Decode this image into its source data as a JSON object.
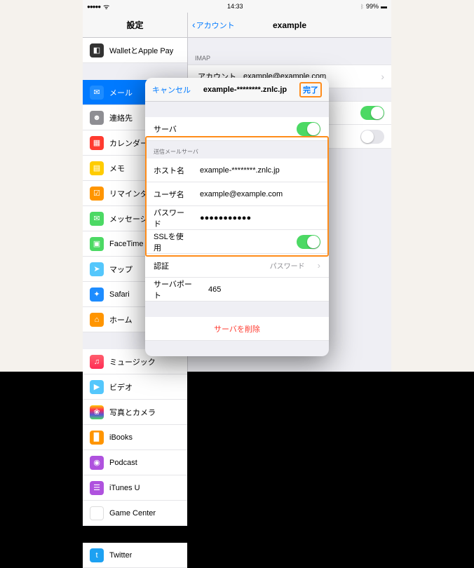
{
  "status": {
    "signal": "●●●●●",
    "time": "14:33",
    "battery_pct": "99%",
    "bt": "⚊",
    "wifi": "▾"
  },
  "left": {
    "title": "設定",
    "wallet": "WalletとApple Pay",
    "items": [
      {
        "id": "mail",
        "label": "メール"
      },
      {
        "id": "contacts",
        "label": "連絡先"
      },
      {
        "id": "cal",
        "label": "カレンダー"
      },
      {
        "id": "notes",
        "label": "メモ"
      },
      {
        "id": "rem",
        "label": "リマインダー"
      },
      {
        "id": "msg",
        "label": "メッセージ"
      },
      {
        "id": "ft",
        "label": "FaceTime"
      },
      {
        "id": "maps",
        "label": "マップ"
      },
      {
        "id": "safari",
        "label": "Safari"
      },
      {
        "id": "home",
        "label": "ホーム"
      }
    ],
    "items2": [
      {
        "id": "music",
        "label": "ミュージック"
      },
      {
        "id": "video",
        "label": "ビデオ"
      },
      {
        "id": "photo",
        "label": "写真とカメラ"
      },
      {
        "id": "ibooks",
        "label": "iBooks"
      },
      {
        "id": "podcast",
        "label": "Podcast"
      },
      {
        "id": "itu",
        "label": "iTunes U"
      },
      {
        "id": "gc",
        "label": "Game Center"
      }
    ],
    "items3": [
      {
        "id": "tw",
        "label": "Twitter"
      }
    ]
  },
  "right": {
    "back": "アカウント",
    "title": "example",
    "imap_h": "IMAP",
    "account_k": "アカウント",
    "account_v": "example@example.com"
  },
  "modal": {
    "cancel": "キャンセル",
    "title": "example-********.znlc.jp",
    "done": "完了",
    "server_row": "サーバ",
    "section": "送信メールサーバ",
    "host_k": "ホスト名",
    "host_v": "example-********.znlc.jp",
    "user_k": "ユーザ名",
    "user_v": "example@example.com",
    "pw_k": "パスワード",
    "pw_v": "●●●●●●●●●●●",
    "ssl_k": "SSLを使用",
    "auth_k": "認証",
    "auth_v": "パスワード",
    "port_k": "サーバポート",
    "port_v": "465",
    "delete": "サーバを削除"
  }
}
